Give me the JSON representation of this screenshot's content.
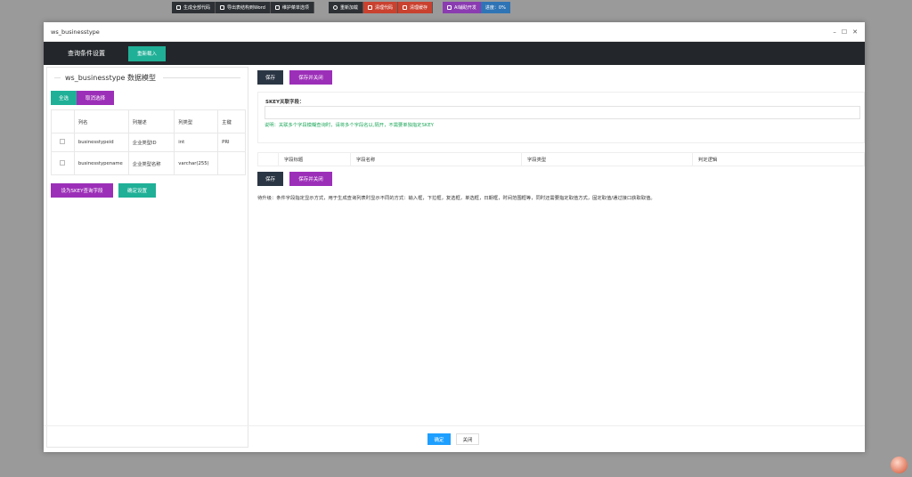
{
  "toolbar_group1": [
    {
      "label": "生成全部代码",
      "icon": "edit-icon"
    },
    {
      "label": "导出表结构到Word",
      "icon": "edit-icon"
    },
    {
      "label": "维护菜单选项",
      "icon": "edit-icon"
    }
  ],
  "toolbar_group2": [
    {
      "label": "重新加载",
      "icon": "refresh-icon"
    },
    {
      "label": "清理代码",
      "icon": "brush-icon"
    },
    {
      "label": "清理缓存",
      "icon": "brush-icon"
    }
  ],
  "toolbar_group3": {
    "ai_label": "AI辅助开发",
    "progress_label": "进度：0%",
    "progress": 0
  },
  "modal": {
    "title": "ws_businesstype",
    "query_tab": "查询条件设置",
    "reload_button": "重新载入"
  },
  "left": {
    "legend": "ws_businesstype 数据模型",
    "select_all": "全选",
    "cancel_select": "取消选择",
    "headers": [
      "列名",
      "列描述",
      "列类型",
      "主键"
    ],
    "rows": [
      {
        "name": "businesstypeid",
        "desc": "企业类型ID",
        "type": "int",
        "pk": "PRI"
      },
      {
        "name": "businesstypename",
        "desc": "企业类型名称",
        "type": "varchar(255)",
        "pk": ""
      }
    ],
    "set_skey_button": "设为SKEY查询字段",
    "confirm_button": "确定设置"
  },
  "right": {
    "save": "保存",
    "save_close": "保存并关闭",
    "skey_label": "SKEY关联字段：",
    "skey_value": "",
    "note": "说明：关联多个字段模糊查询时，请将多个字段名以,隔开，不需要单独指定SKEY",
    "field_headers": [
      "",
      "字段标题",
      "字段名称",
      "字段类型",
      "判定逻辑"
    ],
    "tip": "待升级：条件字段指定显示方式，用于生成查询列表时显示不同的方式：输入框，下拉框，复选框，单选框，日期框，时间范围框等，同时还需要指定取值方式，固定取值/通过接口获取取值。"
  },
  "footer": {
    "ok": "确定",
    "close": "关闭"
  },
  "colors": {
    "teal": "#20b097",
    "purple": "#9c2fb8",
    "dark": "#2b3644",
    "blue": "#1e9fff"
  }
}
